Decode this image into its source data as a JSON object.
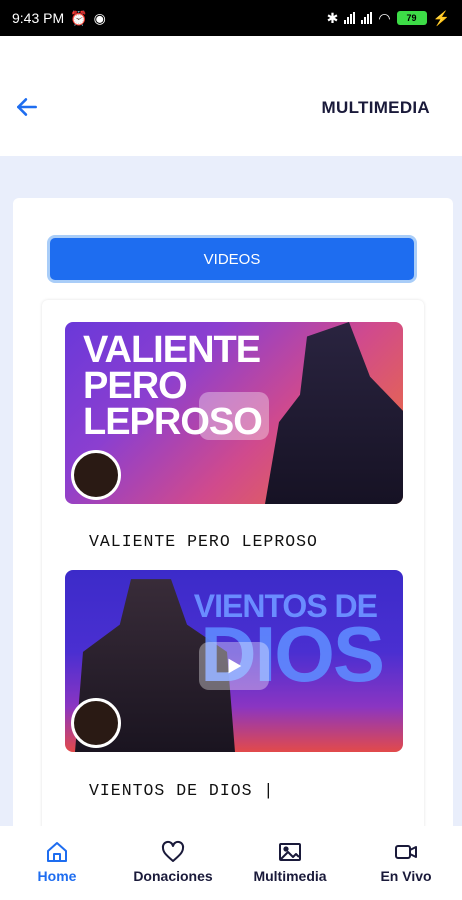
{
  "status_bar": {
    "time": "9:43 PM",
    "battery": "79"
  },
  "header": {
    "title": "MULTIMEDIA",
    "back_icon": "arrow-left-icon"
  },
  "tabs": {
    "videos_label": "VIDEOS"
  },
  "videos": [
    {
      "thumbnail_title": "VALIENTE PERO LEPROSO",
      "caption": "VALIENTE PERO LEPROSO"
    },
    {
      "thumbnail_title_top": "VIENTOS DE",
      "thumbnail_title_bottom": "DIOS",
      "caption": "VIENTOS DE DIOS |"
    }
  ],
  "bottom_nav": {
    "home": "Home",
    "donations": "Donaciones",
    "multimedia": "Multimedia",
    "live": "En Vivo"
  },
  "colors": {
    "accent": "#1e6df0",
    "background": "#e9eefb",
    "text_dark": "#1a1a3a"
  }
}
